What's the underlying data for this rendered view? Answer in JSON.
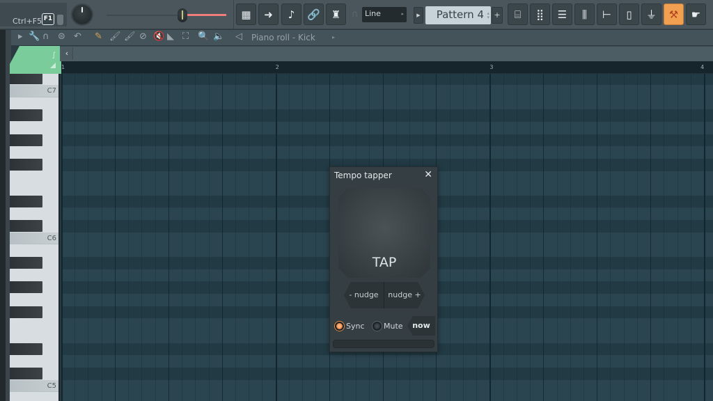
{
  "toolbar": {
    "hint_text": "Ctrl+F5",
    "hint_key": "F1",
    "icons": [
      {
        "name": "piano-roll-icon",
        "glyph": "▦"
      },
      {
        "name": "arrow-right-icon",
        "glyph": "➜"
      },
      {
        "name": "step-icon",
        "glyph": "♪"
      },
      {
        "name": "link-icon",
        "glyph": "🔗"
      },
      {
        "name": "metronome-hat-icon",
        "glyph": "♜"
      }
    ],
    "snap_select": "Line",
    "pattern": "Pattern 4",
    "pattern_add": "+",
    "right_icons": [
      {
        "name": "playlist-icon",
        "glyph": "⌸",
        "active": false
      },
      {
        "name": "channel-rack-icon",
        "glyph": "⣿",
        "active": false
      },
      {
        "name": "mixer-list-icon",
        "glyph": "☰",
        "active": false
      },
      {
        "name": "mixer-icon",
        "glyph": "⫼",
        "active": false
      },
      {
        "name": "browser-tree-icon",
        "glyph": "⊢",
        "active": false
      },
      {
        "name": "document-icon",
        "glyph": "▯",
        "active": false
      },
      {
        "name": "plugin-plug-icon",
        "glyph": "⏚",
        "active": false
      },
      {
        "name": "tempo-tapper-icon",
        "glyph": "⚒",
        "active": true
      },
      {
        "name": "touch-hand-icon",
        "glyph": "☛",
        "active": false
      }
    ]
  },
  "piano_roll_toolbar": {
    "title": "Piano roll - Kick",
    "tools": [
      {
        "name": "menu-arrow-icon",
        "glyph": "▸"
      },
      {
        "name": "wrench-icon",
        "glyph": "🔧"
      },
      {
        "name": "magnet-icon",
        "glyph": "∩"
      },
      {
        "name": "snap-circle-icon",
        "glyph": "⊜"
      },
      {
        "name": "undo-icon",
        "glyph": "↶"
      },
      {
        "name": "pencil-icon",
        "glyph": "✎"
      },
      {
        "name": "paint-brush-icon",
        "glyph": "🖌"
      },
      {
        "name": "paint-brush-alt-icon",
        "glyph": "🖌"
      },
      {
        "name": "delete-icon",
        "glyph": "⊘"
      },
      {
        "name": "mute-icon",
        "glyph": "🔇"
      },
      {
        "name": "slice-icon",
        "glyph": "◣"
      },
      {
        "name": "select-icon",
        "glyph": "⛶"
      },
      {
        "name": "zoom-icon",
        "glyph": "🔍"
      },
      {
        "name": "playback-icon",
        "glyph": "🔈"
      },
      {
        "name": "speaker-icon",
        "glyph": "◁"
      }
    ]
  },
  "ruler": {
    "bars": [
      "1",
      "2",
      "3",
      "4"
    ]
  },
  "keys": {
    "labels": [
      "C7",
      "C6",
      "C5"
    ]
  },
  "tempo_tapper": {
    "title": "Tempo tapper",
    "close": "✕",
    "tap_label": "TAP",
    "nudge_minus": "- nudge",
    "nudge_plus": "nudge +",
    "sync_label": "Sync",
    "sync_on": true,
    "mute_label": "Mute",
    "mute_on": false,
    "now_label": "now"
  },
  "colors": {
    "accent_green": "#7acc9a",
    "active_orange": "#f0a050",
    "pitch_red": "#f07c7c",
    "grid_bg": "#2a414b"
  }
}
